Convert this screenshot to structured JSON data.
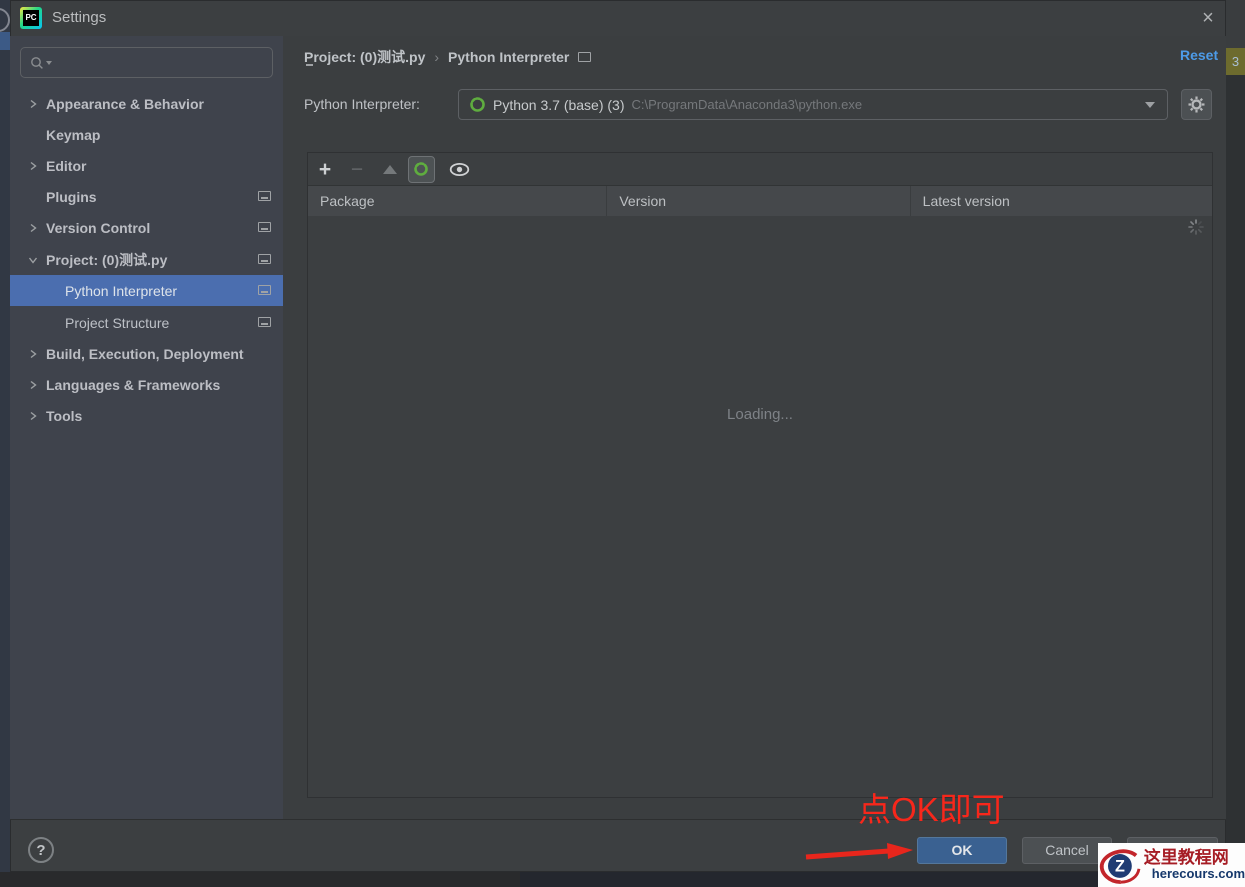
{
  "window": {
    "title": "Settings",
    "close_glyph": "×",
    "logo_text": "PC"
  },
  "underlying_window": {
    "right_edge_badge": "3"
  },
  "sidebar": {
    "search": {
      "value": "",
      "placeholder": ""
    },
    "items": [
      {
        "label": "Appearance & Behavior"
      },
      {
        "label": "Keymap"
      },
      {
        "label": "Editor"
      },
      {
        "label": "Plugins"
      },
      {
        "label": "Version Control"
      },
      {
        "label": "Project: (0)测试.py"
      },
      {
        "label": "Python Interpreter"
      },
      {
        "label": "Project Structure"
      },
      {
        "label": "Build, Execution, Deployment"
      },
      {
        "label": "Languages & Frameworks"
      },
      {
        "label": "Tools"
      }
    ]
  },
  "header": {
    "breadcrumb_project": "Project: (0)测试.py",
    "breadcrumb_separator": "›",
    "breadcrumb_page": "Python Interpreter",
    "reset_label": "Reset"
  },
  "interpreter": {
    "label": "Python Interpreter:",
    "value": "Python 3.7 (base) (3)",
    "path": "C:\\ProgramData\\Anaconda3\\python.exe"
  },
  "packages_table": {
    "columns": [
      "Package",
      "Version",
      "Latest version"
    ],
    "loading_text": "Loading..."
  },
  "footer": {
    "help_glyph": "?",
    "ok_label": "OK",
    "cancel_label": "Cancel"
  },
  "annotation": {
    "text": "点OK即可"
  },
  "watermark": {
    "site_name": "这里教程网",
    "site_domain": "herecours.com",
    "logo_letter": "Z"
  },
  "colors": {
    "accent_selection": "#4b6eaf",
    "link_blue": "#4d9be8",
    "ok_blue": "#3a6191",
    "conda_green": "#5fad3f",
    "annotation_red": "#f7271b"
  }
}
